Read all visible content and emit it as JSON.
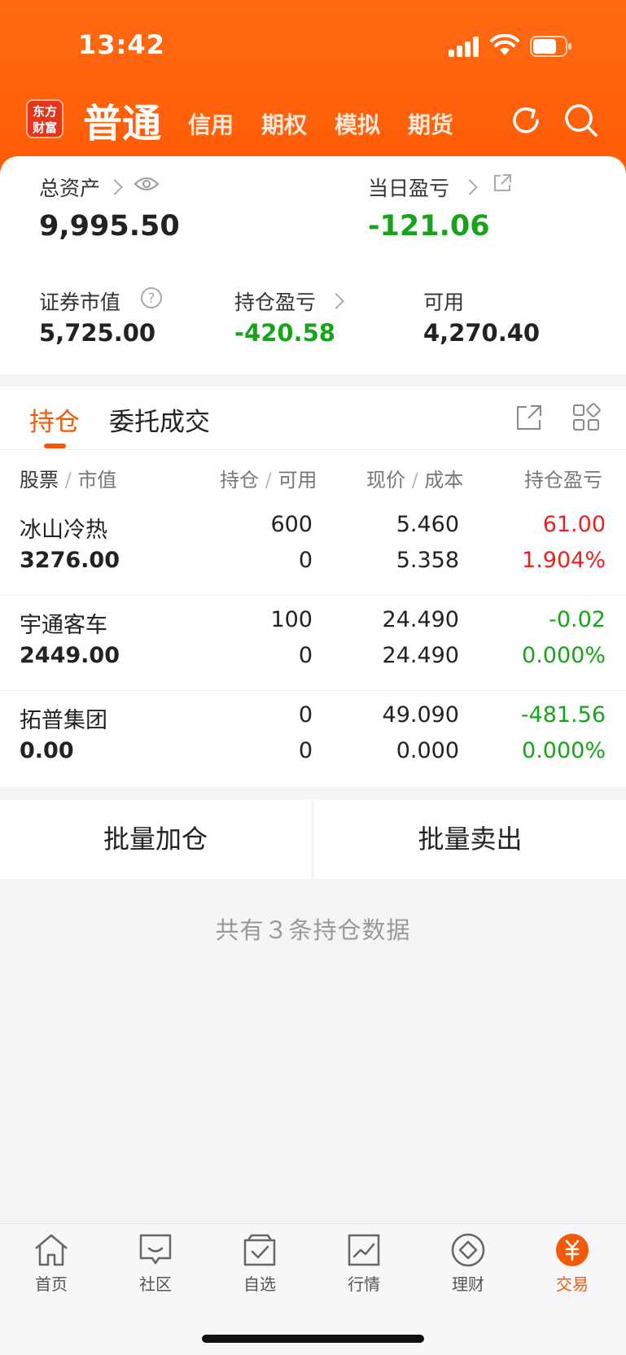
{
  "status_bar": {
    "time": "13:42"
  },
  "navbar": {
    "logo_line1": "东方",
    "logo_line2": "财富",
    "active_tab": "普通",
    "tabs": [
      "信用",
      "期权",
      "模拟",
      "期货"
    ]
  },
  "account": {
    "total_assets_label": "总资产",
    "total_assets_value": "9,995.50",
    "daily_pnl_label": "当日盈亏",
    "daily_pnl_value": "-121.06",
    "market_value_label": "证券市值",
    "market_value_value": "5,725.00",
    "position_pnl_label": "持仓盈亏",
    "position_pnl_value": "-420.58",
    "available_label": "可用",
    "available_value": "4,270.40"
  },
  "holdings": {
    "tabs": [
      "持仓",
      "委托成交"
    ],
    "columns": {
      "stock": "股票",
      "market_value": "市值",
      "position": "持仓",
      "available": "可用",
      "price": "现价",
      "cost": "成本",
      "pnl": "持仓盈亏"
    },
    "rows": [
      {
        "name": "冰山冷热",
        "value": "3276.00",
        "position": "600",
        "available": "0",
        "price": "5.460",
        "cost": "5.358",
        "pnl": "61.00",
        "pnl_pct": "1.904%",
        "trend": "up"
      },
      {
        "name": "宇通客车",
        "value": "2449.00",
        "position": "100",
        "available": "0",
        "price": "24.490",
        "cost": "24.490",
        "pnl": "-0.02",
        "pnl_pct": "0.000%",
        "trend": "down"
      },
      {
        "name": "拓普集团",
        "value": "0.00",
        "position": "0",
        "available": "0",
        "price": "49.090",
        "cost": "0.000",
        "pnl": "-481.56",
        "pnl_pct": "0.000%",
        "trend": "down"
      }
    ]
  },
  "actions": {
    "batch_buy": "批量加仓",
    "batch_sell": "批量卖出"
  },
  "summary": "共有３条持仓数据",
  "tabbar": {
    "items": [
      {
        "label": "首页",
        "icon": "home-icon"
      },
      {
        "label": "社区",
        "icon": "community-icon"
      },
      {
        "label": "自选",
        "icon": "watchlist-icon"
      },
      {
        "label": "行情",
        "icon": "market-icon"
      },
      {
        "label": "理财",
        "icon": "wealth-icon"
      },
      {
        "label": "交易",
        "icon": "trade-icon"
      }
    ]
  },
  "colors": {
    "accent": "#f25a0a",
    "up": "#e8231f",
    "down": "#17a41a",
    "header": "#ff5a05"
  }
}
